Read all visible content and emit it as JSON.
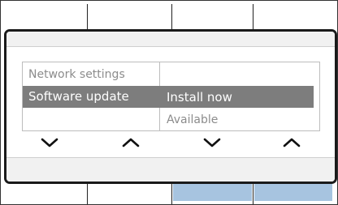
{
  "menu": {
    "left_items": [
      "Network settings",
      "Software update"
    ],
    "right_items": [
      "Install now",
      "Available"
    ],
    "selected_index": 1
  },
  "softkeys": {
    "icons": [
      "chevron-down-icon",
      "chevron-up-icon",
      "chevron-down-icon",
      "chevron-up-icon"
    ]
  },
  "colors": {
    "frame": "#1a1a1a",
    "selected_row": "#7d7d7d",
    "muted_text": "#8c8c8c",
    "bottom_button": "#a7c4e0"
  }
}
